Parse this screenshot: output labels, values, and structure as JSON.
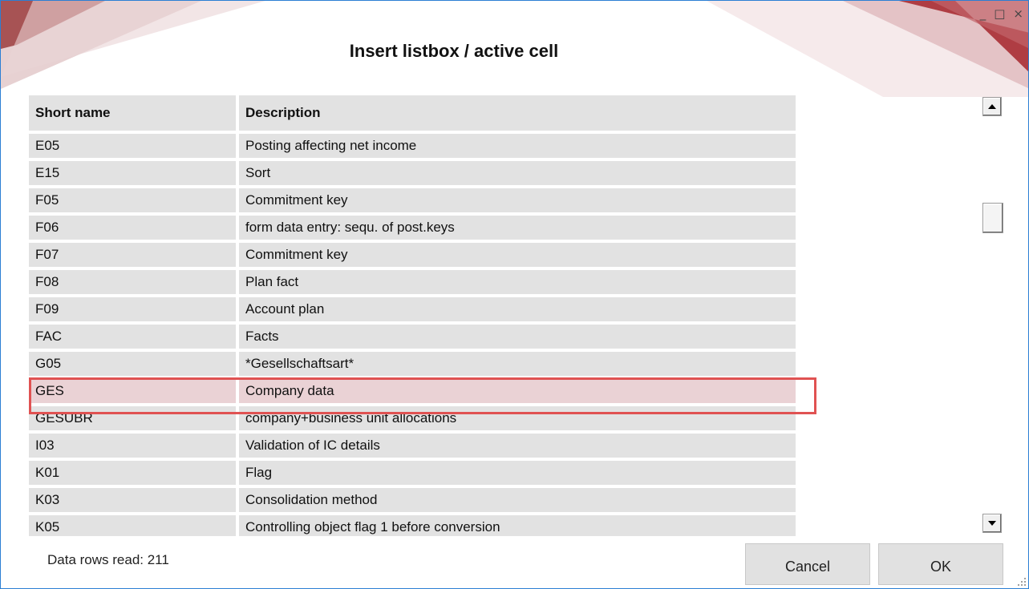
{
  "window": {
    "title": "Insert listbox / active cell",
    "controls": {
      "minimize": "_",
      "maximize": "□",
      "close": "×"
    }
  },
  "grid": {
    "columns": [
      "Short name",
      "Description"
    ],
    "rows": [
      [
        "E05",
        "Posting affecting net income"
      ],
      [
        "E15",
        "Sort"
      ],
      [
        "F05",
        "Commitment key"
      ],
      [
        "F06",
        "form data entry: sequ. of post.keys"
      ],
      [
        "F07",
        "Commitment key"
      ],
      [
        "F08",
        "Plan fact"
      ],
      [
        "F09",
        "Account plan"
      ],
      [
        "FAC",
        "Facts"
      ],
      [
        "G05",
        "*Gesellschaftsart*"
      ],
      [
        "GES",
        "Company data"
      ],
      [
        "GESUBR",
        "company+business unit allocations"
      ],
      [
        "I03",
        "Validation of IC details"
      ],
      [
        "K01",
        "Flag"
      ],
      [
        "K03",
        "Consolidation method"
      ],
      [
        "K05",
        "Controlling object flag 1 before conversion"
      ]
    ],
    "selected_row": "GES"
  },
  "footer": {
    "status": "Data rows read: 211",
    "cancel_label": "Cancel",
    "ok_label": "OK"
  },
  "colors": {
    "cell_bg": "#e2e2e2",
    "selected_bg": "#ead2d5",
    "highlight_border": "#e05252",
    "accent": "#8b1a1a"
  },
  "icons": [
    "scroll-up-icon",
    "scroll-down-icon",
    "resize-grip-icon"
  ]
}
